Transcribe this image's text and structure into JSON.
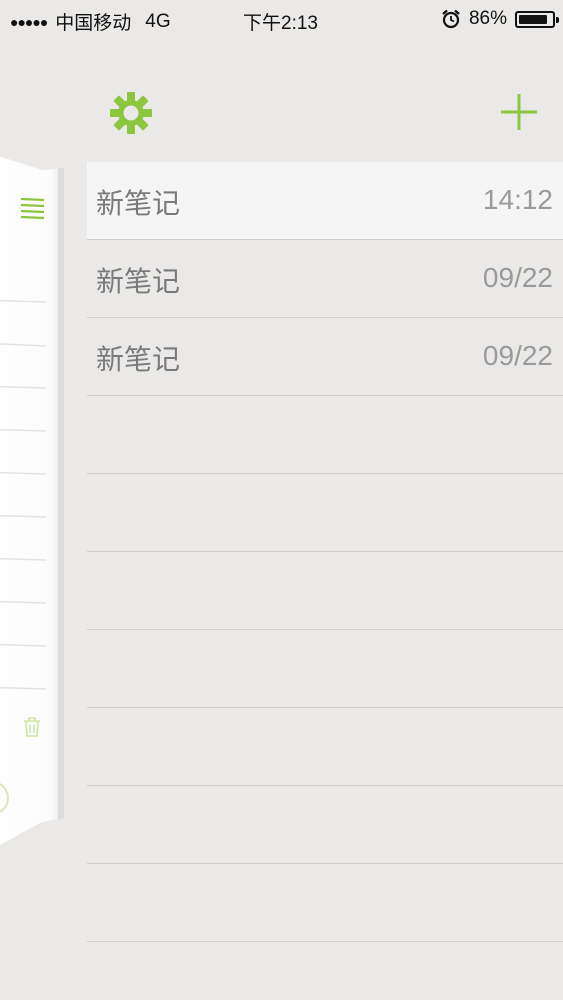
{
  "status_bar": {
    "signal": "●●●●●",
    "carrier": "中国移动",
    "network": "4G",
    "time": "下午2:13",
    "battery_percent": "86%",
    "battery_level": 0.86,
    "alarm_icon": "alarm-clock-icon"
  },
  "toolbar": {
    "settings_icon": "gear-icon",
    "add_icon": "plus-icon",
    "accent_color": "#8cc63f"
  },
  "side_panel": {
    "menu_icon": "hamburger-menu-icon",
    "trash_icon": "trash-icon"
  },
  "notes": [
    {
      "title": "新笔记",
      "date": "14:12",
      "selected": true
    },
    {
      "title": "新笔记",
      "date": "09/22",
      "selected": false
    },
    {
      "title": "新笔记",
      "date": "09/22",
      "selected": false
    },
    {
      "title": "",
      "date": "",
      "selected": false
    },
    {
      "title": "",
      "date": "",
      "selected": false
    },
    {
      "title": "",
      "date": "",
      "selected": false
    },
    {
      "title": "",
      "date": "",
      "selected": false
    },
    {
      "title": "",
      "date": "",
      "selected": false
    },
    {
      "title": "",
      "date": "",
      "selected": false
    },
    {
      "title": "",
      "date": "",
      "selected": false
    }
  ]
}
